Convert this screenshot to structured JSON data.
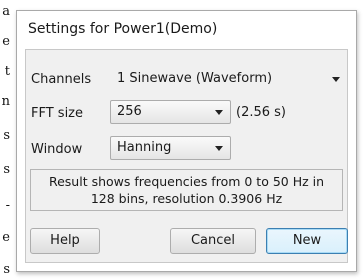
{
  "background": {
    "left_chars": [
      "a",
      "e",
      "t",
      "n",
      "s",
      "s",
      "-",
      "e",
      "s"
    ],
    "right_chars": [
      "",
      "",
      "",
      "",
      ""
    ]
  },
  "dialog": {
    "title": "Settings for Power1(Demo)"
  },
  "channels": {
    "label": "Channels",
    "value": "1 Sinewave (Waveform)"
  },
  "fft_size": {
    "label": "FFT size",
    "value": "256",
    "duration": "(2.56 s)"
  },
  "window": {
    "label": "Window",
    "value": "Hanning"
  },
  "info": {
    "line1": "Result shows frequencies from 0 to 50 Hz in",
    "line2": "128 bins, resolution 0.3906 Hz"
  },
  "buttons": {
    "help": "Help",
    "cancel": "Cancel",
    "new": "New"
  },
  "colors": {
    "default_button_border": "#3c7fb1",
    "client_background": "#f0f0f0"
  }
}
